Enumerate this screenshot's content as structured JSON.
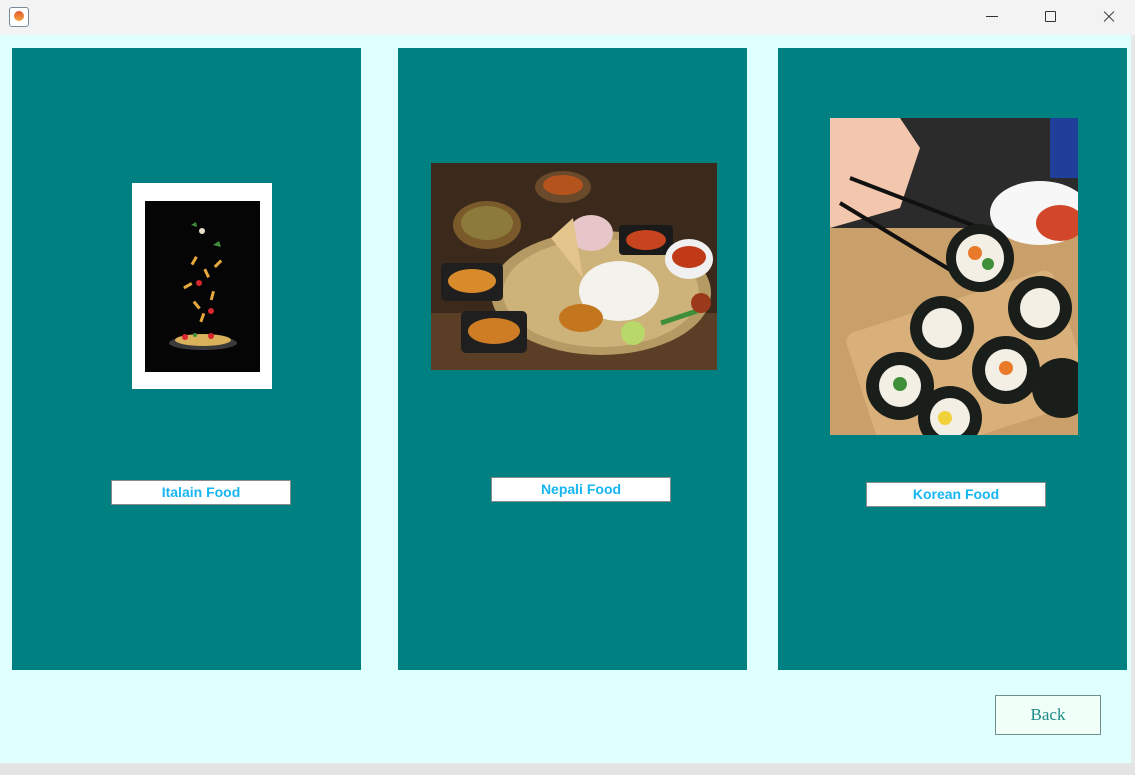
{
  "window": {
    "app_icon": "java-cup-icon",
    "controls": [
      "minimize-icon",
      "maximize-icon",
      "close-icon"
    ]
  },
  "colors": {
    "background": "#e0ffff",
    "panel": "#008080",
    "label_text": "#16b6f2",
    "back_text": "#1f8a8a"
  },
  "cards": [
    {
      "label": "Italain Food"
    },
    {
      "label": "Nepali Food"
    },
    {
      "label": "Korean Food"
    }
  ],
  "back_label": "Back"
}
